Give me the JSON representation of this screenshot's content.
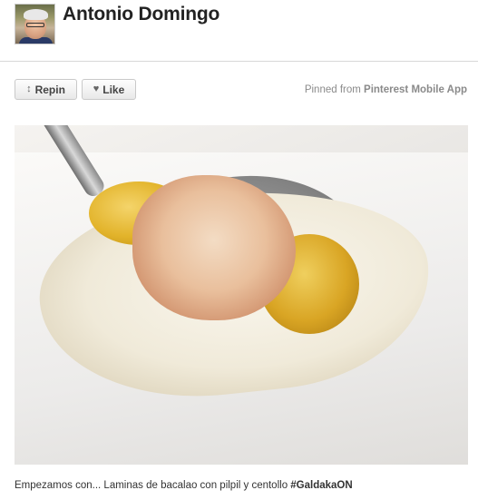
{
  "pin": {
    "user_name": "Antonio Domingo",
    "repin_label": "Repin",
    "like_label": "Like",
    "pinned_from_prefix": "Pinned from",
    "pinned_from_source": "Pinterest Mobile App",
    "caption_text": "Empezamos con... Laminas de bacalao con pilpil y centollo ",
    "caption_hashtag": "#GaldakaON"
  },
  "icons": {
    "repin": "repin-icon",
    "like": "heart-icon"
  }
}
